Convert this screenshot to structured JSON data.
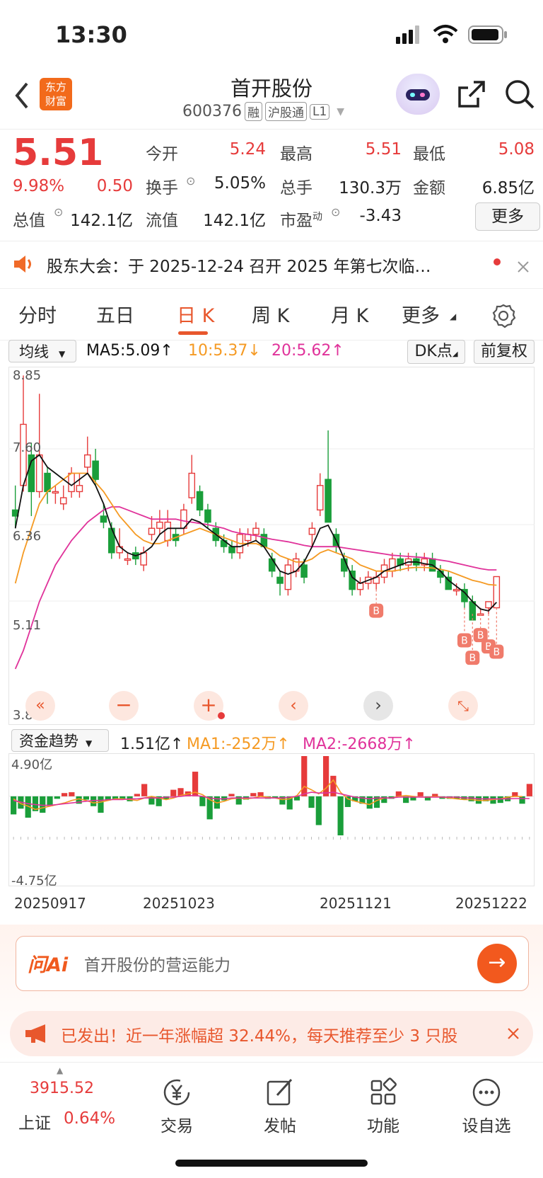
{
  "status_bar": {
    "time": "13:30"
  },
  "header": {
    "back_icon": "chevron-left-icon",
    "logo_text_1": "东方",
    "logo_text_2": "财富",
    "stock_name": "首开股份",
    "stock_code": "600376",
    "tags": [
      "融",
      "沪股通",
      "L1"
    ],
    "share_icon": "share-icon",
    "search_icon": "search-icon"
  },
  "quote": {
    "price": "5.51",
    "change_pct": "9.98%",
    "change_amt": "0.50",
    "open_label": "今开",
    "open": "5.24",
    "high_label": "最高",
    "high": "5.51",
    "low_label": "最低",
    "low": "5.08",
    "turnover_label": "换手",
    "turnover": "5.05%",
    "volume_label": "总手",
    "volume": "130.3万",
    "amount_label": "金额",
    "amount": "6.85亿",
    "mktcap_label": "总值",
    "mktcap": "142.1亿",
    "float_label": "流值",
    "float": "142.1亿",
    "pe_label": "市盈",
    "pe_sup": "动",
    "pe": "-3.43",
    "more_label": "更多"
  },
  "notice": {
    "text": "股东大会：于 2025-12-24 召开 2025 年第七次临…"
  },
  "tabs": [
    "分时",
    "五日",
    "日 K",
    "周 K",
    "月 K",
    "更多"
  ],
  "ma_bar": {
    "selector": "均线",
    "ma5": "MA5:5.09↑",
    "ma10": "10:5.37↓",
    "ma20": "20:5.62↑",
    "dk": "DK点",
    "adjust": "前复权"
  },
  "kline": {
    "y_labels": [
      "8.85",
      "7.60",
      "6.36",
      "5.11",
      "3.87"
    ],
    "ylim": [
      3.87,
      8.85
    ],
    "buy_marker": "B",
    "colors": {
      "up": "#e63b3b",
      "down": "#1a9e3a",
      "ma5": "#111111",
      "ma10": "#f59a23",
      "ma20": "#e0329a"
    }
  },
  "flow": {
    "selector": "资金趋势",
    "value": "1.51亿↑",
    "ma1": "MA1:-252万↑",
    "ma2": "MA2:-2668万↑",
    "top_label": "4.90亿",
    "bottom_label": "-4.75亿"
  },
  "x_dates": [
    "20250917",
    "20251023",
    "20251121",
    "20251222"
  ],
  "ai": {
    "brand": "问Ai",
    "placeholder": "首开股份的营运能力"
  },
  "promo": {
    "text": "已发出！近一年涨幅超 32.44%，每天推荐至少 3 只股"
  },
  "bottom_nav": {
    "index_value": "3915.52",
    "index_name": "上证",
    "index_change": "0.64%",
    "items": [
      "交易",
      "发帖",
      "功能",
      "设自选"
    ]
  },
  "chart_data": {
    "type": "candlestick",
    "ylim": [
      3.87,
      8.85
    ],
    "candles": [
      [
        6.6,
        7.0,
        6.3,
        6.5
      ],
      [
        7.0,
        8.8,
        6.9,
        8.0
      ],
      [
        7.5,
        7.7,
        6.5,
        6.9
      ],
      [
        6.9,
        8.5,
        6.8,
        7.5
      ],
      [
        7.2,
        7.3,
        6.7,
        6.9
      ],
      [
        6.9,
        7.0,
        6.7,
        6.9
      ],
      [
        6.7,
        7.0,
        6.6,
        6.8
      ],
      [
        6.9,
        7.3,
        6.8,
        7.2
      ],
      [
        6.9,
        7.2,
        6.8,
        7.0
      ],
      [
        7.3,
        7.8,
        7.2,
        7.5
      ],
      [
        7.4,
        7.6,
        7.0,
        7.1
      ],
      [
        6.5,
        6.7,
        6.3,
        6.4
      ],
      [
        6.3,
        6.4,
        5.8,
        5.9
      ],
      [
        5.9,
        6.3,
        5.8,
        6.0
      ],
      [
        5.8,
        5.9,
        5.7,
        5.8
      ],
      [
        5.9,
        6.0,
        5.7,
        5.8
      ],
      [
        5.7,
        6.0,
        5.6,
        5.9
      ],
      [
        6.2,
        6.5,
        6.1,
        6.3
      ],
      [
        6.3,
        6.6,
        6.2,
        6.4
      ],
      [
        6.1,
        6.6,
        6.0,
        6.4
      ],
      [
        6.2,
        6.3,
        6.0,
        6.1
      ],
      [
        6.3,
        6.7,
        6.2,
        6.6
      ],
      [
        6.8,
        7.5,
        6.7,
        7.2
      ],
      [
        6.9,
        7.0,
        6.5,
        6.6
      ],
      [
        6.6,
        6.7,
        6.3,
        6.4
      ],
      [
        6.3,
        6.4,
        6.0,
        6.1
      ],
      [
        6.1,
        6.2,
        5.9,
        6.0
      ],
      [
        6.0,
        6.1,
        5.8,
        5.9
      ],
      [
        5.9,
        6.3,
        5.8,
        6.2
      ],
      [
        6.1,
        6.3,
        6.0,
        6.2
      ],
      [
        6.2,
        6.4,
        6.1,
        6.3
      ],
      [
        6.2,
        6.3,
        6.0,
        6.0
      ],
      [
        5.8,
        5.9,
        5.5,
        5.6
      ],
      [
        5.5,
        5.6,
        5.2,
        5.4
      ],
      [
        5.3,
        5.8,
        5.2,
        5.7
      ],
      [
        5.6,
        5.9,
        5.5,
        5.8
      ],
      [
        5.7,
        5.8,
        5.4,
        5.5
      ],
      [
        6.2,
        6.4,
        6.0,
        6.3
      ],
      [
        6.6,
        7.2,
        6.5,
        7.0
      ],
      [
        7.1,
        7.9,
        6.4,
        6.4
      ],
      [
        6.2,
        6.3,
        5.9,
        6.0
      ],
      [
        5.8,
        5.9,
        5.5,
        5.6
      ],
      [
        5.6,
        5.7,
        5.2,
        5.3
      ],
      [
        5.3,
        5.5,
        5.2,
        5.4
      ],
      [
        5.4,
        5.6,
        5.3,
        5.5
      ],
      [
        5.4,
        5.6,
        5.3,
        5.5
      ],
      [
        5.5,
        5.8,
        5.4,
        5.7
      ],
      [
        5.6,
        5.9,
        5.5,
        5.8
      ],
      [
        5.8,
        5.9,
        5.6,
        5.7
      ],
      [
        5.7,
        5.9,
        5.6,
        5.8
      ],
      [
        5.8,
        5.9,
        5.6,
        5.7
      ],
      [
        5.7,
        5.9,
        5.6,
        5.8
      ],
      [
        5.8,
        5.9,
        5.6,
        5.6
      ],
      [
        5.6,
        5.7,
        5.4,
        5.5
      ],
      [
        5.5,
        5.6,
        5.3,
        5.3
      ],
      [
        5.3,
        5.4,
        5.2,
        5.3
      ],
      [
        5.3,
        5.4,
        5.0,
        5.1
      ],
      [
        5.1,
        5.2,
        4.9,
        4.8
      ],
      [
        4.9,
        5.0,
        4.9,
        4.9
      ],
      [
        5.0,
        5.1,
        4.9,
        5.1
      ],
      [
        5.0,
        5.5,
        5.0,
        5.51
      ]
    ],
    "ma5": [
      6.3,
      7.0,
      7.4,
      7.5,
      7.3,
      7.2,
      7.1,
      7.0,
      7.1,
      7.2,
      7.0,
      6.7,
      6.3,
      6.0,
      5.9,
      5.85,
      5.9,
      6.0,
      6.2,
      6.3,
      6.3,
      6.3,
      6.45,
      6.4,
      6.3,
      6.2,
      6.1,
      6.0,
      6.0,
      6.05,
      6.1,
      6.0,
      5.8,
      5.6,
      5.55,
      5.6,
      5.75,
      6.0,
      6.3,
      6.35,
      6.1,
      5.8,
      5.5,
      5.4,
      5.45,
      5.5,
      5.6,
      5.65,
      5.7,
      5.75,
      5.75,
      5.72,
      5.7,
      5.6,
      5.45,
      5.35,
      5.25,
      5.1,
      4.98,
      4.95,
      5.09
    ],
    "ma10": [
      5.4,
      5.9,
      6.3,
      6.7,
      6.9,
      7.0,
      7.1,
      7.2,
      7.2,
      7.2,
      7.05,
      6.9,
      6.7,
      6.5,
      6.35,
      6.2,
      6.1,
      6.05,
      6.05,
      6.1,
      6.15,
      6.2,
      6.25,
      6.3,
      6.25,
      6.2,
      6.15,
      6.1,
      6.05,
      6.05,
      6.05,
      6.0,
      5.95,
      5.85,
      5.8,
      5.75,
      5.75,
      5.8,
      5.9,
      5.95,
      5.9,
      5.85,
      5.8,
      5.7,
      5.65,
      5.6,
      5.6,
      5.6,
      5.62,
      5.65,
      5.66,
      5.66,
      5.65,
      5.63,
      5.6,
      5.55,
      5.5,
      5.45,
      5.42,
      5.38,
      5.37
    ],
    "ma20": [
      4.0,
      4.3,
      4.7,
      5.1,
      5.4,
      5.7,
      5.9,
      6.1,
      6.25,
      6.4,
      6.5,
      6.6,
      6.65,
      6.65,
      6.6,
      6.55,
      6.5,
      6.45,
      6.45,
      6.45,
      6.45,
      6.42,
      6.4,
      6.38,
      6.36,
      6.33,
      6.3,
      6.25,
      6.22,
      6.2,
      6.18,
      6.15,
      6.12,
      6.1,
      6.08,
      6.05,
      6.02,
      6.0,
      6.0,
      6.0,
      6.0,
      5.98,
      5.96,
      5.94,
      5.92,
      5.9,
      5.88,
      5.86,
      5.85,
      5.84,
      5.83,
      5.82,
      5.8,
      5.78,
      5.76,
      5.73,
      5.7,
      5.67,
      5.64,
      5.62,
      5.62
    ],
    "flow": [
      -2.2,
      -1.5,
      -2.6,
      -1.8,
      -2.0,
      -1.2,
      -0.3,
      0.4,
      0.5,
      -0.9,
      -0.4,
      -1.2,
      -2.0,
      -0.5,
      -0.4,
      -0.4,
      -0.6,
      0.3,
      1.5,
      -1.0,
      -1.2,
      -0.4,
      0.8,
      1.0,
      0.6,
      3.0,
      -1.2,
      -2.8,
      -1.5,
      -0.5,
      0.3,
      -1.0,
      -0.4,
      0.4,
      0.5,
      -0.3,
      -0.2,
      -1.0,
      -1.6,
      -0.5,
      4.9,
      -1.4,
      -3.5,
      4.9,
      2.5,
      -4.75,
      -1.3,
      -0.6,
      -0.9,
      -1.5,
      -1.4,
      -0.8,
      -0.3,
      0.6,
      -0.8,
      -0.5,
      0.5,
      -0.5,
      0.3,
      -0.3,
      -0.3,
      -0.3,
      -0.4,
      -0.6,
      -0.9,
      -0.6,
      -0.9,
      -0.8,
      -0.6,
      0.5,
      -0.9,
      1.51
    ],
    "flow_ma1": [
      -0.3,
      -0.9,
      -1.2,
      -1.6,
      -1.4,
      -1.2,
      -1.0,
      -0.8,
      -0.5,
      -0.3,
      -0.5,
      -0.8,
      -0.7,
      -0.5,
      -0.3,
      -0.3,
      -0.4,
      -0.5,
      -0.2,
      0.0,
      -0.2,
      -0.4,
      -0.2,
      0.1,
      0.3,
      0.5,
      0.2,
      -0.4,
      -0.8,
      -0.6,
      -0.3,
      -0.2,
      -0.3,
      -0.2,
      0.0,
      -0.1,
      -0.2,
      -0.4,
      -0.3,
      0.1,
      1.2,
      0.8,
      0.3,
      1.0,
      2.0,
      0.5,
      -0.3,
      -0.6,
      -0.8,
      -1.0,
      -0.5,
      -0.2,
      -0.2,
      0.0,
      0.1,
      0.0,
      -0.1,
      -0.1,
      0.0,
      -0.1,
      -0.2,
      -0.3,
      -0.4,
      -0.4,
      -0.5,
      -0.5,
      -0.4,
      -0.3,
      -0.1,
      0.0,
      -0.03
    ],
    "flow_ma2": [
      -0.5,
      -0.7,
      -0.9,
      -1.0,
      -1.1,
      -1.1,
      -1.0,
      -0.9,
      -0.8,
      -0.7,
      -0.6,
      -0.5,
      -0.5,
      -0.4,
      -0.4,
      -0.4,
      -0.3,
      -0.3,
      -0.2,
      -0.2,
      -0.2,
      -0.1,
      -0.1,
      0.0,
      0.1,
      0.1,
      0.0,
      -0.2,
      -0.3,
      -0.3,
      -0.2,
      -0.2,
      -0.2,
      -0.2,
      -0.2,
      -0.2,
      -0.2,
      -0.2,
      -0.1,
      0.0,
      0.3,
      0.5,
      0.4,
      0.4,
      0.5,
      0.3,
      0.1,
      -0.1,
      -0.2,
      -0.3,
      -0.2,
      -0.2,
      -0.2,
      -0.1,
      -0.1,
      -0.1,
      -0.1,
      -0.1,
      -0.1,
      -0.1,
      -0.1,
      -0.1,
      -0.2,
      -0.2,
      -0.3,
      -0.3,
      -0.3,
      -0.3,
      -0.3,
      -0.27,
      -0.27,
      -0.27
    ],
    "buy_signals": [
      45,
      56,
      57,
      58,
      59,
      60
    ]
  }
}
